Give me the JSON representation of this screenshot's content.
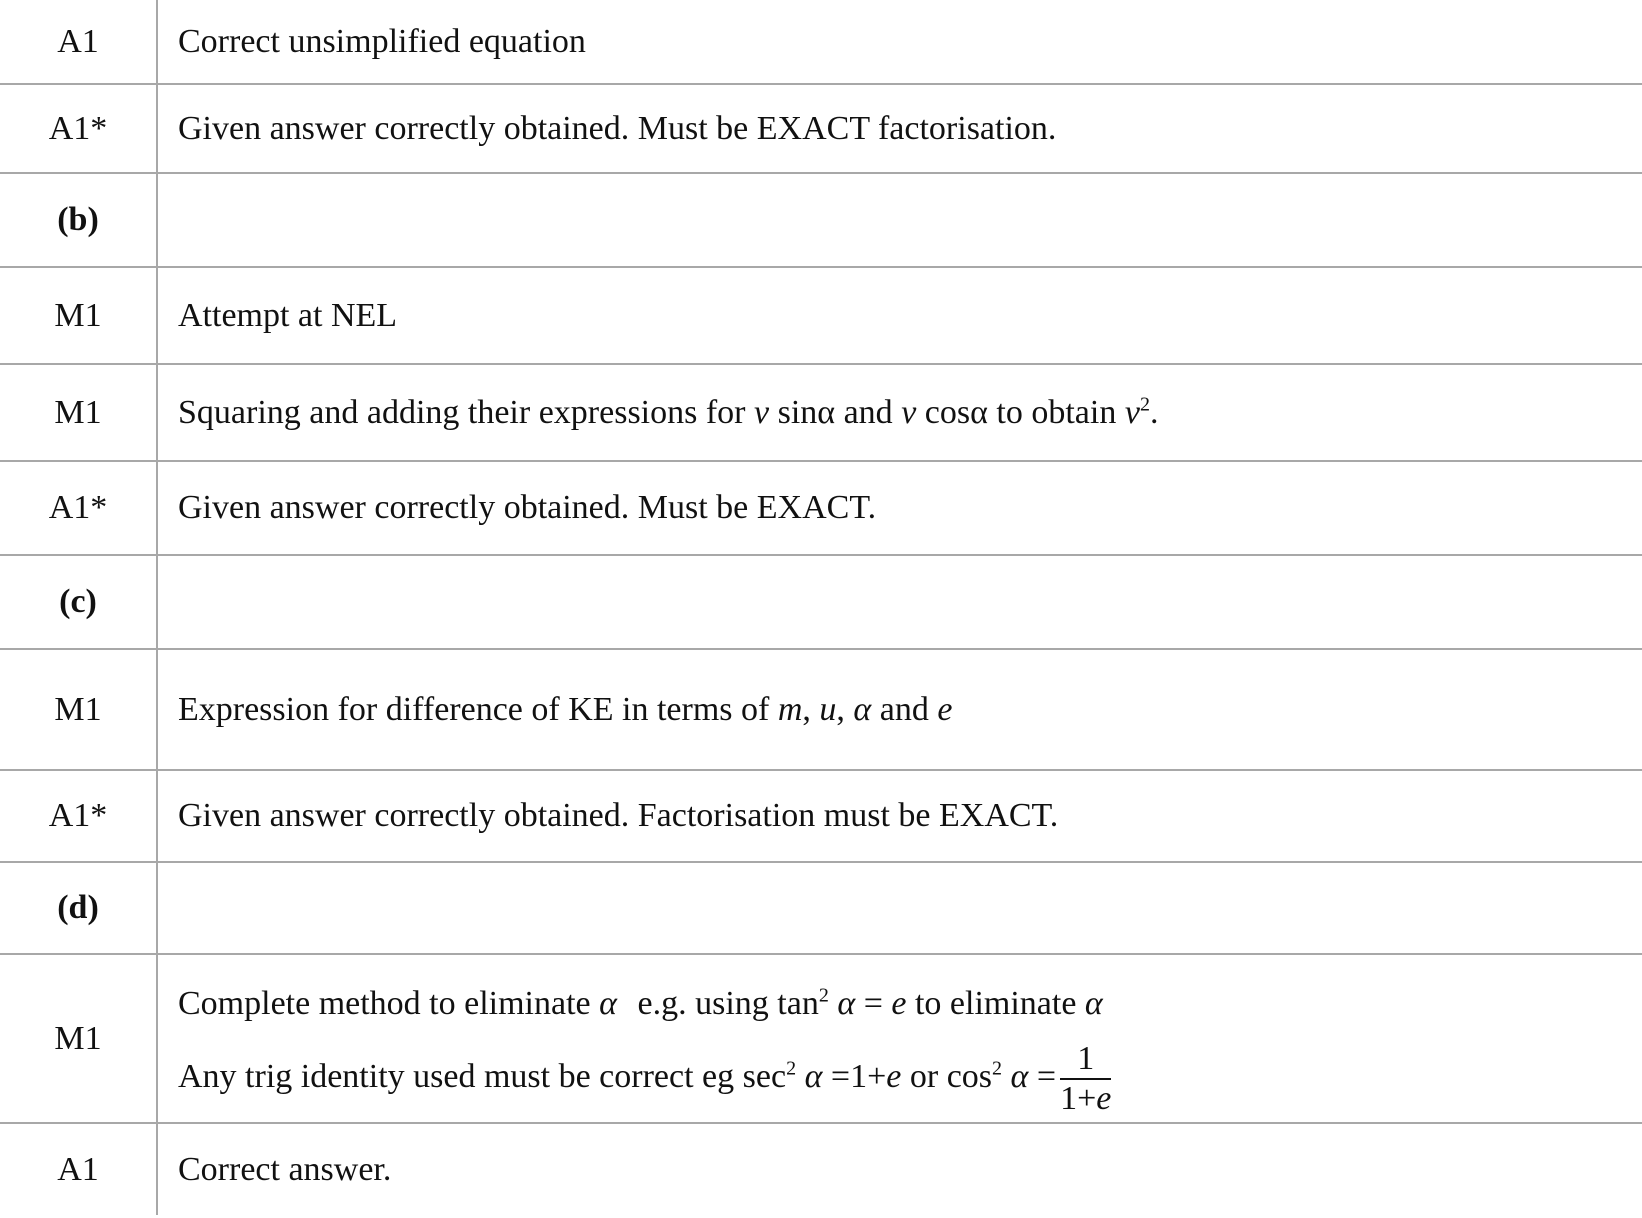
{
  "rows": [
    {
      "mark": "A1",
      "text": "Correct unsimplified equation"
    },
    {
      "mark": "A1*",
      "text": "Given answer correctly obtained. Must be EXACT factorisation."
    },
    {
      "part": "(b)"
    },
    {
      "mark": "M1",
      "text": "Attempt at NEL"
    },
    {
      "mark": "M1",
      "parts": {
        "a": "Squaring and adding their expressions for ",
        "v1": "v",
        "b": " sinα and ",
        "v2": "v",
        "c": " cosα to obtain ",
        "v3": "v",
        "sup": "2",
        "d": "."
      }
    },
    {
      "mark": "A1*",
      "text": "Given answer correctly obtained. Must be EXACT."
    },
    {
      "part": "(c)"
    },
    {
      "mark": "M1",
      "parts": {
        "a": "Expression for difference of KE in terms of ",
        "m": "m",
        "comma1": ", ",
        "u": "u",
        "comma2": ", ",
        "alpha": "α",
        "and": " and ",
        "e": "e"
      }
    },
    {
      "mark": "A1*",
      "text": "Given answer correctly obtained. Factorisation must be EXACT."
    },
    {
      "part": "(d)"
    },
    {
      "mark": "M1",
      "line1": {
        "a": "Complete method to eliminate ",
        "alpha1": "α",
        "b": " e.g. using ",
        "tan": "tan",
        "sup": "2",
        "expr_alpha": "α",
        "expr_rest": " = ",
        "expr_e": "e",
        "c": " to eliminate ",
        "alpha2": "α"
      },
      "line2": {
        "a": "Any trig identity used must be correct eg ",
        "sec": "sec",
        "sup1": "2",
        "alpha1": "α",
        "eq1": " =1+",
        "e1": "e",
        "or": " or ",
        "cos": "cos",
        "sup2": "2",
        "alpha2": "α",
        "eq2": " =",
        "num": "1",
        "den_a": "1+",
        "den_e": "e"
      }
    },
    {
      "mark": "A1",
      "text": "Correct answer."
    }
  ]
}
